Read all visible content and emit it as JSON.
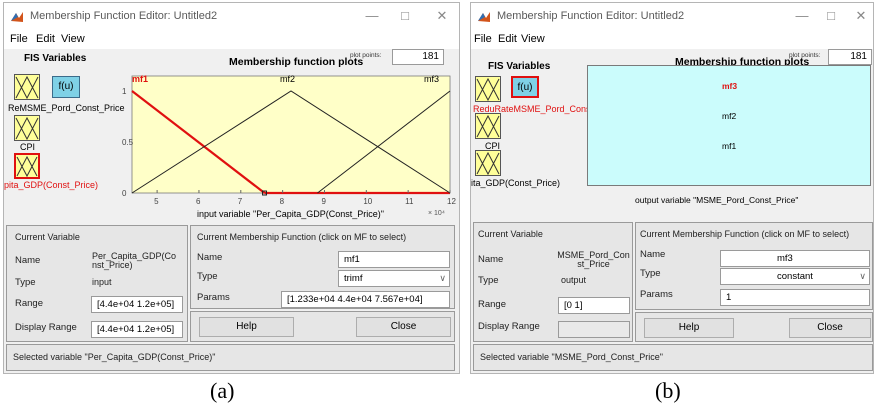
{
  "left": {
    "title": "Membership Function Editor: Untitled2",
    "menu": [
      "File",
      "Edit",
      "View"
    ],
    "fis_variables_label": "FIS Variables",
    "fu_label": "f(u)",
    "variables": {
      "reduced_overlap": "ReMSME_Pord_Const_Price",
      "cpi": "CPI",
      "gdp": "pita_GDP(Const_Price)"
    },
    "plot": {
      "title": "Membership function plots",
      "plot_points_label": "plot points:",
      "plot_points_value": "181",
      "xlabel": "input variable \"Per_Capita_GDP(Const_Price)\"",
      "exponent": "× 10⁴",
      "x_ticks": [
        "5",
        "6",
        "7",
        "8",
        "9",
        "10",
        "11",
        "12"
      ],
      "y_ticks": [
        "0",
        "0.5",
        "1"
      ]
    },
    "current_variable": {
      "header": "Current Variable",
      "name_label": "Name",
      "name_value": "Per_Capita_GDP(Const_Price)",
      "type_label": "Type",
      "type_value": "input",
      "range_label": "Range",
      "range_value": "[4.4e+04 1.2e+05]",
      "display_range_label": "Display Range",
      "display_range_value": "[4.4e+04 1.2e+05]"
    },
    "current_mf": {
      "header": "Current Membership Function (click on MF to select)",
      "name_label": "Name",
      "name_value": "mf1",
      "type_label": "Type",
      "type_value": "trimf",
      "params_label": "Params",
      "params_value": "[1.233e+04 4.4e+04 7.567e+04]"
    },
    "help_label": "Help",
    "close_label": "Close",
    "status": "Selected variable \"Per_Capita_GDP(Const_Price)\""
  },
  "right": {
    "title": "Membership Function Editor: Untitled2",
    "menu": [
      "File",
      "Edit",
      "View"
    ],
    "fis_variables_label": "FIS Variables",
    "fu_label": "f(u)",
    "variables": {
      "reduced_overlap": "ReduRateMSME_Pord_Const_Price",
      "cpi": "CPI",
      "gdp": "ita_GDP(Const_Price)"
    },
    "plot": {
      "title": "Membership function plots",
      "plot_points_label": "plot points:",
      "plot_points_value": "181",
      "output_label": "output variable \"MSME_Pord_Const_Price\"",
      "mf_labels": [
        "mf3",
        "mf2",
        "mf1"
      ]
    },
    "current_variable": {
      "header": "Current Variable",
      "name_label": "Name",
      "name_value": "MSME_Pord_Const_Price",
      "type_label": "Type",
      "type_value": "output",
      "range_label": "Range",
      "range_value": "[0 1]",
      "display_range_label": "Display Range",
      "display_range_value": ""
    },
    "current_mf": {
      "header": "Current Membership Function (click on MF to select)",
      "name_label": "Name",
      "name_value": "mf3",
      "type_label": "Type",
      "type_value": "constant",
      "params_label": "Params",
      "params_value": "1"
    },
    "help_label": "Help",
    "close_label": "Close",
    "status": "Selected variable \"MSME_Pord_Const_Price\""
  },
  "captions": [
    "(a)",
    "(b)"
  ],
  "chart_data": {
    "type": "line",
    "xlabel": "input variable \"Per_Capita_GDP(Const_Price)\"",
    "ylabel": "",
    "xlim": [
      4.4,
      12
    ],
    "ylim": [
      0,
      1
    ],
    "x_unit_multiplier": "× 10⁴",
    "series": [
      {
        "name": "mf1",
        "x": [
          1.233,
          4.4,
          7.567
        ],
        "y": [
          0,
          1,
          0
        ],
        "selected": true
      },
      {
        "name": "mf2",
        "x": [
          4.4,
          8.2,
          12.0
        ],
        "y": [
          0,
          1,
          0
        ]
      },
      {
        "name": "mf3",
        "x": [
          8.833,
          12.0,
          15.17
        ],
        "y": [
          0,
          1,
          0
        ]
      }
    ]
  },
  "colors": {
    "plot_bg": "#ffffc8",
    "output_plot_bg": "#cbfcfc",
    "selected": "#e01010",
    "fu_fill": "#7fd1e6",
    "var_fill": "#ffff99"
  }
}
